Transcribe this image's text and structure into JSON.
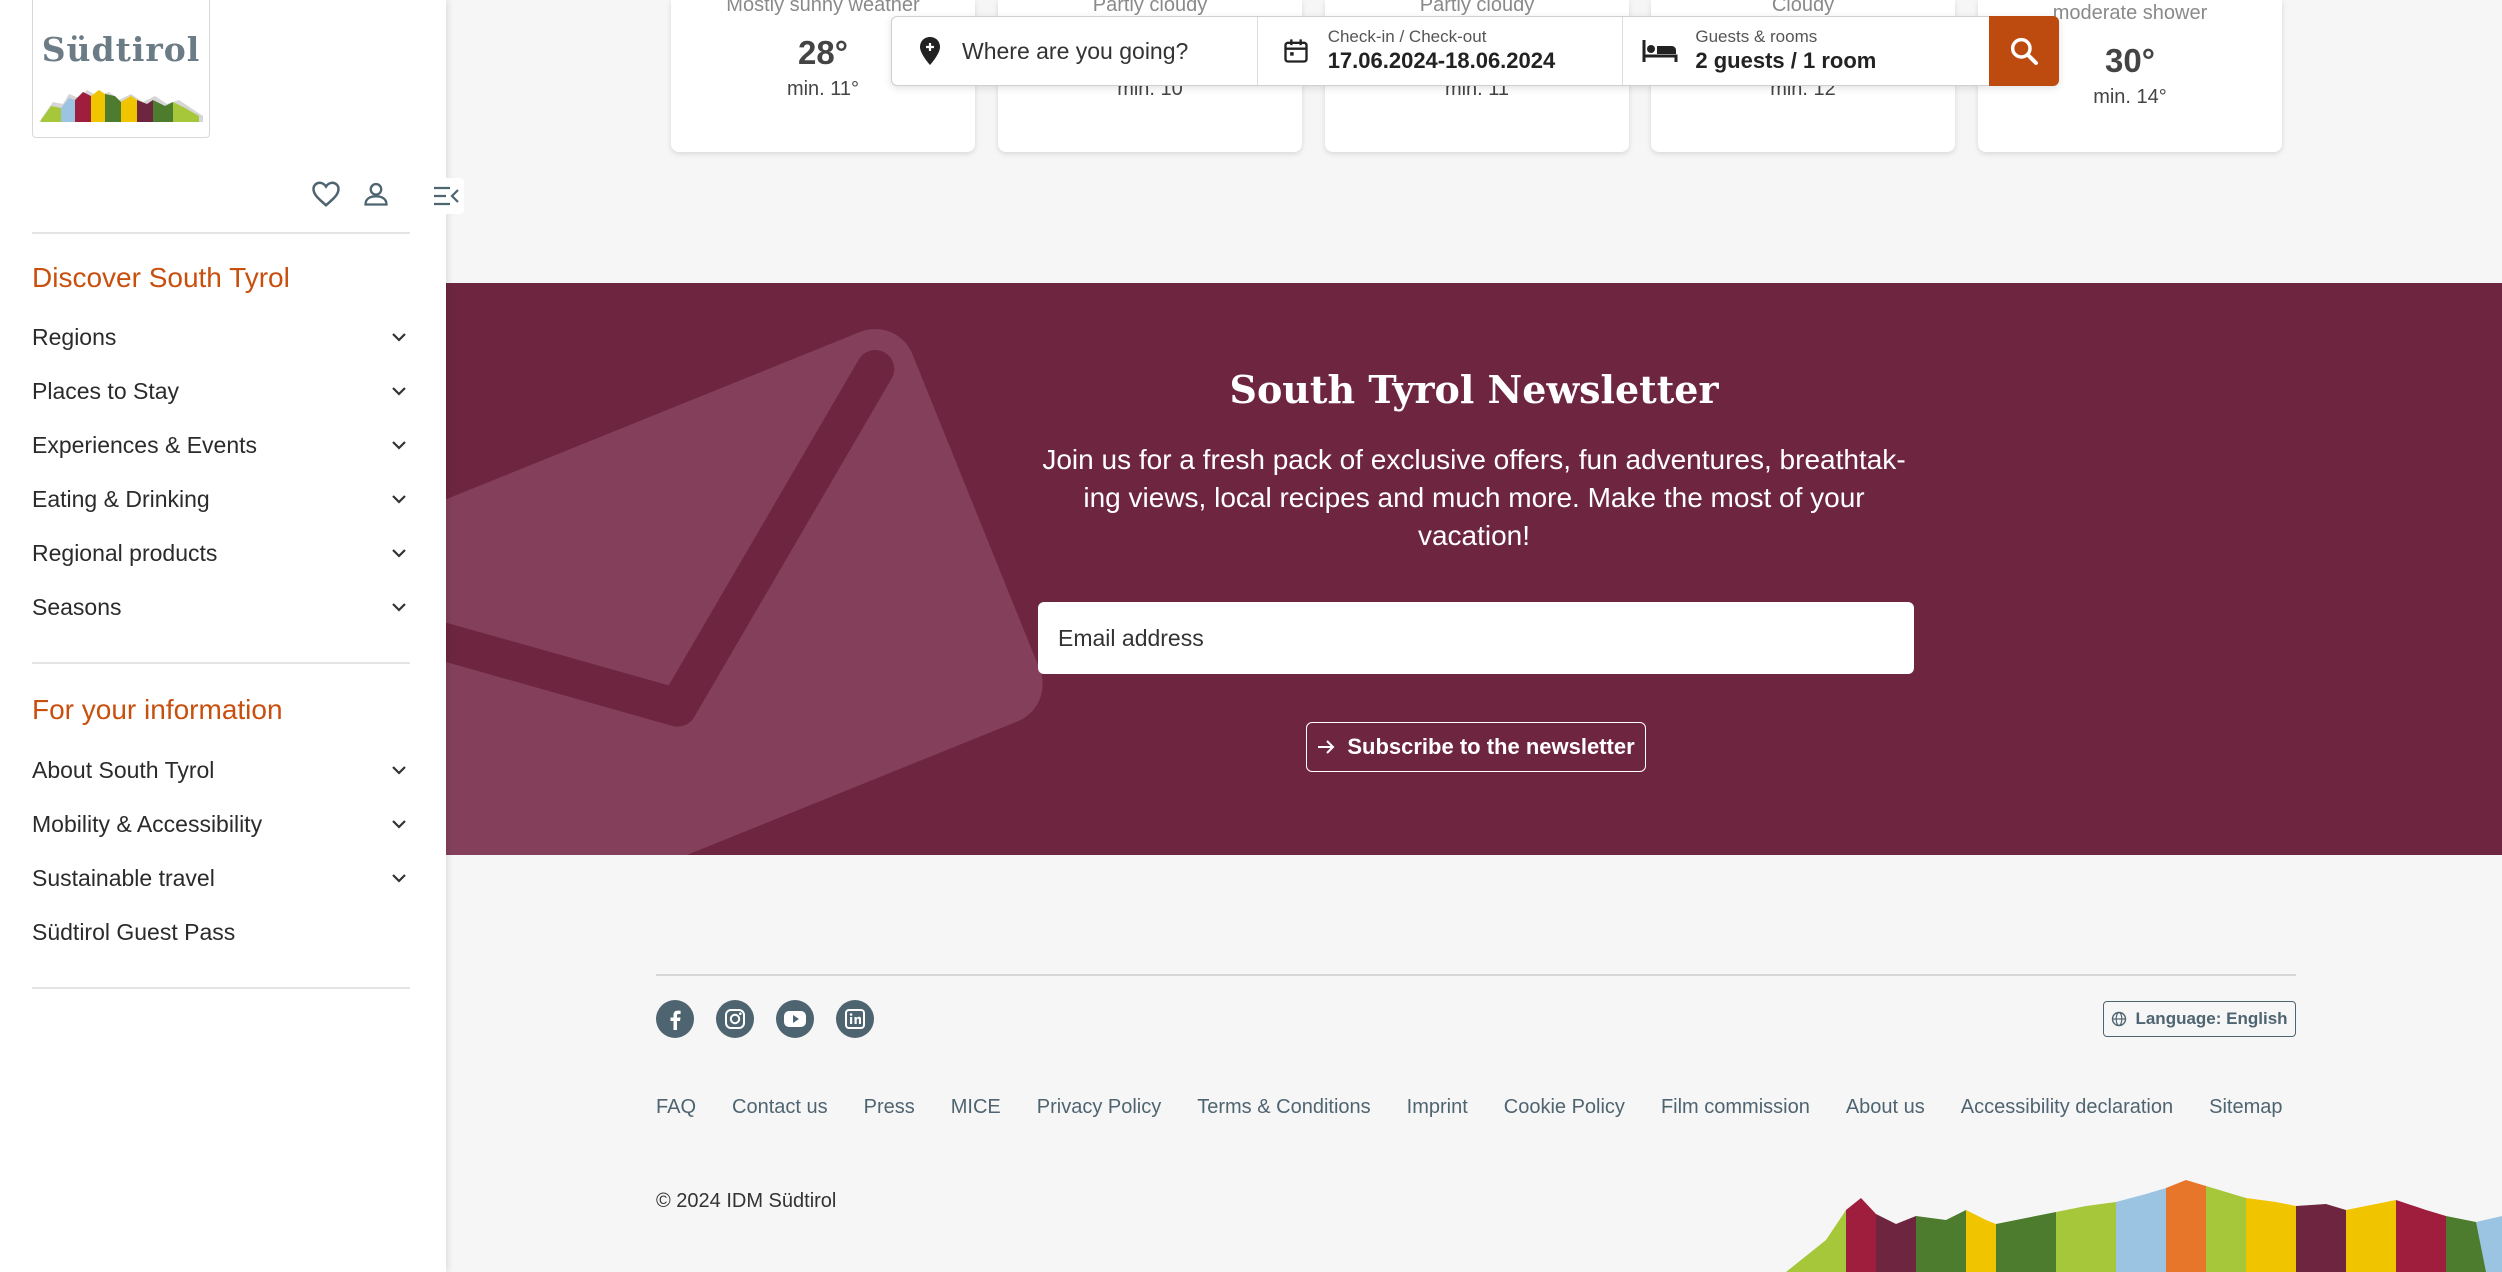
{
  "brand": {
    "logo_text": "Südtirol"
  },
  "sidebar": {
    "section1": {
      "heading": "Discover South Tyrol",
      "items": [
        {
          "label": "Regions"
        },
        {
          "label": "Places to Stay"
        },
        {
          "label": "Experiences & Events"
        },
        {
          "label": "Eating & Drinking"
        },
        {
          "label": "Regional products"
        },
        {
          "label": "Seasons"
        }
      ]
    },
    "section2": {
      "heading": "For your information",
      "items": [
        {
          "label": "About South Tyrol"
        },
        {
          "label": "Mobility & Accessibility"
        },
        {
          "label": "Sustainable travel"
        },
        {
          "label": "Südtirol Guest Pass"
        }
      ]
    },
    "icons": [
      "heart-icon",
      "user-icon",
      "menu-collapse-icon",
      "chevron-down-icon"
    ]
  },
  "weather": [
    {
      "condition": "Mostly sunny weather",
      "max": "28°",
      "min": "min. 11°"
    },
    {
      "condition": "Partly cloudy",
      "max": "",
      "min": "min. 10"
    },
    {
      "condition": "Partly cloudy",
      "max": "",
      "min": "min. 11"
    },
    {
      "condition": "Cloudy",
      "max": "",
      "min": "min. 12"
    },
    {
      "condition": "moderate shower",
      "max": "30°",
      "min": "min. 14°"
    }
  ],
  "booking": {
    "where_placeholder": "Where are you going?",
    "dates_label": "Check-in / Check-out",
    "dates_value": "17.06.2024-18.06.2024",
    "guests_label": "Guests & rooms",
    "guests_value": "2 guests / 1 room",
    "search_icon": "search-icon"
  },
  "newsletter": {
    "title": "South Tyrol Newsletter",
    "text": "Join us for a fresh pack of exclusive offers, fun adventures, breathtak­ing views, local recipes and much more. Make the most of your vacation!",
    "email_placeholder": "Email address",
    "button_label": "Subscribe to the newsletter"
  },
  "footer": {
    "social": [
      "facebook-icon",
      "instagram-icon",
      "youtube-icon",
      "linkedin-icon"
    ],
    "language_label": "Language: English",
    "links": [
      "FAQ",
      "Contact us",
      "Press",
      "MICE",
      "Privacy Policy",
      "Terms & Conditions",
      "Imprint",
      "Cookie Policy",
      "Film commission",
      "About us",
      "Accessibility declaration",
      "Sitemap"
    ],
    "copyright": "© 2024 IDM Südtirol"
  },
  "colors": {
    "accent": "#c8500f",
    "newsletter_bg": "#6e2640",
    "search_btn": "#bd4a0e",
    "footer_text": "#4f6471"
  }
}
